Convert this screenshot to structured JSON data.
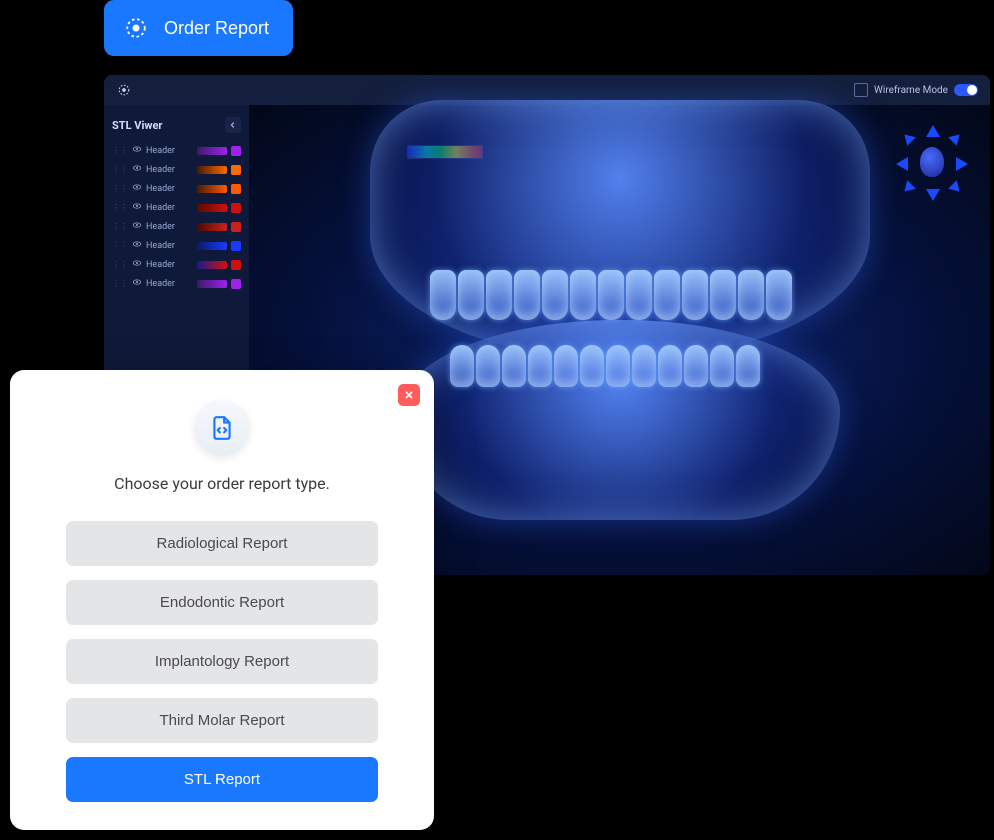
{
  "order_button": {
    "label": "Order Report"
  },
  "viewer": {
    "header": {
      "wireframe_label": "Wireframe Mode"
    },
    "sidebar": {
      "title": "STL Viwer",
      "layers": [
        {
          "label": "Header",
          "slider": "linear-gradient(90deg,#3a1a6a,#a020f0)",
          "swatch": "#a020f0"
        },
        {
          "label": "Header",
          "slider": "linear-gradient(90deg,#4a1a00,#ff6a00)",
          "swatch": "#ff6a00"
        },
        {
          "label": "Header",
          "slider": "linear-gradient(90deg,#4a1a00,#ff5a00)",
          "swatch": "#ff5a00"
        },
        {
          "label": "Header",
          "slider": "linear-gradient(90deg,#5a0a00,#d01010)",
          "swatch": "#d01010"
        },
        {
          "label": "Header",
          "slider": "linear-gradient(90deg,#4a0a00,#cc2020)",
          "swatch": "#cc2020"
        },
        {
          "label": "Header",
          "slider": "linear-gradient(90deg,#0a1a6a,#1a3aff)",
          "swatch": "#1a3aff"
        },
        {
          "label": "Header",
          "slider": "linear-gradient(90deg,#1a1a8a,#d01010)",
          "swatch": "#d01010"
        },
        {
          "label": "Header",
          "slider": "linear-gradient(90deg,#3a1a6a,#a020f0)",
          "swatch": "#a020f0"
        }
      ]
    }
  },
  "modal": {
    "prompt": "Choose your order report type.",
    "options": [
      {
        "label": "Radiological Report",
        "primary": false
      },
      {
        "label": "Endodontic Report",
        "primary": false
      },
      {
        "label": "Implantology Report",
        "primary": false
      },
      {
        "label": "Third Molar Report",
        "primary": false
      },
      {
        "label": "STL Report",
        "primary": true
      }
    ]
  }
}
